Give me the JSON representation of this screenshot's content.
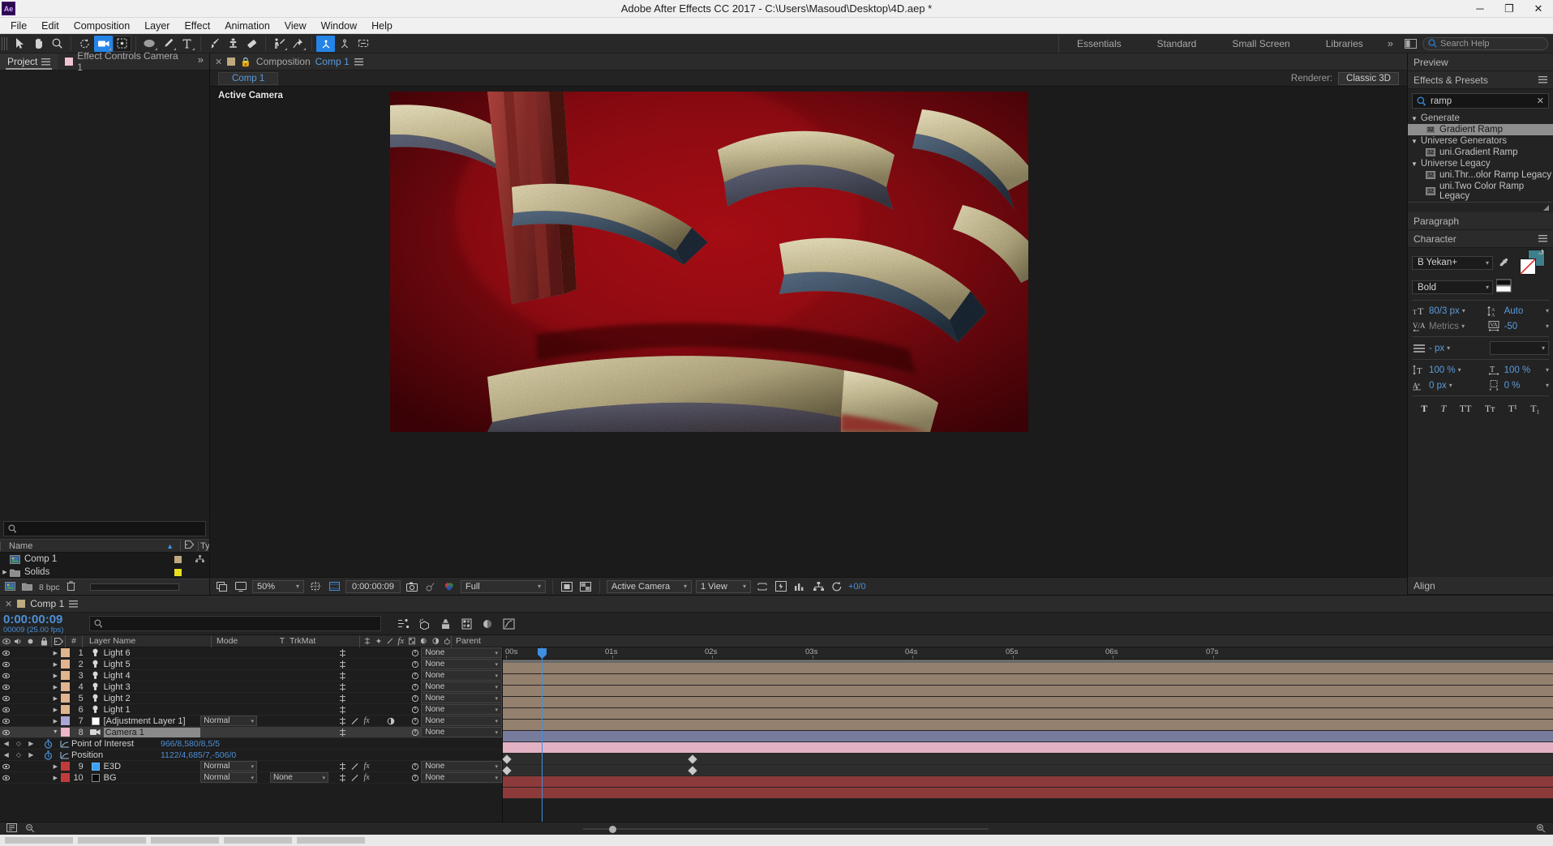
{
  "window": {
    "app_abbrev": "Ae",
    "title": "Adobe After Effects CC 2017 - C:\\Users\\Masoud\\Desktop\\4D.aep *",
    "minimize": "─",
    "maximize": "❐",
    "close": "✕"
  },
  "menubar": [
    "File",
    "Edit",
    "Composition",
    "Layer",
    "Effect",
    "Animation",
    "View",
    "Window",
    "Help"
  ],
  "workspaces": {
    "tabs": [
      "Essentials",
      "Standard",
      "Small Screen",
      "Libraries"
    ],
    "more": "»",
    "search_placeholder": "Search Help"
  },
  "project_panel": {
    "tabs": [
      {
        "label": "Project",
        "active": true
      },
      {
        "label": "Effect Controls  Camera 1",
        "active": false
      }
    ],
    "overflow": "»",
    "search_placeholder": "",
    "columns": [
      "Name",
      "Typ"
    ],
    "items": [
      {
        "name": "Comp 1",
        "kind": "comp",
        "color": "#bfa97e",
        "expandable": false
      },
      {
        "name": "Solids",
        "kind": "folder",
        "color": "#e8e020",
        "expandable": true
      }
    ],
    "bit_depth": "8 bpc"
  },
  "composition_panel": {
    "tab_label": "Composition",
    "tab_comp_name": "Comp 1",
    "breadcrumb": "Comp 1",
    "renderer_label": "Renderer:",
    "renderer_value": "Classic 3D",
    "view_overlay": "Active Camera",
    "bottom_bar": {
      "zoom": "50%",
      "timecode": "0:00:00:09",
      "resolution": "Full",
      "camera": "Active Camera",
      "views": "1 View",
      "frame_offset": "+0/0"
    }
  },
  "preview_panel": {
    "title": "Preview"
  },
  "effects_panel": {
    "title": "Effects & Presets",
    "search_value": "ramp",
    "clear_label": "✕",
    "groups": [
      {
        "name": "Generate",
        "effects": [
          {
            "label": "Gradient Ramp",
            "badge": "32",
            "selected": true
          }
        ]
      },
      {
        "name": "Universe Generators",
        "effects": [
          {
            "label": "uni.Gradient Ramp",
            "badge": "32",
            "selected": false
          }
        ]
      },
      {
        "name": "Universe Legacy",
        "effects": [
          {
            "label": "uni.Thr...olor Ramp Legacy",
            "badge": "32",
            "selected": false
          },
          {
            "label": "uni.Two Color Ramp Legacy",
            "badge": "32",
            "selected": false
          }
        ]
      }
    ]
  },
  "paragraph_panel": {
    "title": "Paragraph"
  },
  "character_panel": {
    "title": "Character",
    "font_family": "B Yekan+",
    "font_style": "Bold",
    "font_size": "80/3 px",
    "leading": "Auto",
    "kerning": "Metrics",
    "tracking": "-50",
    "stroke_width": "- px",
    "stroke_type": "",
    "vertical_scale": "100 %",
    "horizontal_scale": "100 %",
    "baseline_shift": "0 px",
    "tsume": "0 %",
    "fill_color": "#3f7f8c",
    "style_buttons": [
      "T",
      "T",
      "TT",
      "Tᴛ",
      "T¹",
      "T₁"
    ]
  },
  "align_panel": {
    "title": "Align"
  },
  "timeline": {
    "tab_label": "Comp 1",
    "current_time": "0:00:00:09",
    "frame_info": "00009 (25.00 fps)",
    "search_placeholder": "",
    "columns": {
      "hash": "#",
      "layer_name": "Layer Name",
      "mode": "Mode",
      "t": "T",
      "trkmat": "TrkMat",
      "parent": "Parent"
    },
    "ruler_ticks": [
      "00s",
      "01s",
      "02s",
      "03s",
      "04s",
      "05s",
      "06s",
      "07s"
    ],
    "layers": [
      {
        "index": "1",
        "name": "Light 6",
        "type": "light",
        "color": "#e0b48c",
        "bar_color": "#94806e",
        "mode": "",
        "trkmat": "",
        "parent": "None",
        "selected": false,
        "has_fx": false
      },
      {
        "index": "2",
        "name": "Light 5",
        "type": "light",
        "color": "#e0b48c",
        "bar_color": "#94806e",
        "mode": "",
        "trkmat": "",
        "parent": "None",
        "selected": false,
        "has_fx": false
      },
      {
        "index": "3",
        "name": "Light 4",
        "type": "light",
        "color": "#e0b48c",
        "bar_color": "#94806e",
        "mode": "",
        "trkmat": "",
        "parent": "None",
        "selected": false,
        "has_fx": false
      },
      {
        "index": "4",
        "name": "Light 3",
        "type": "light",
        "color": "#e0b48c",
        "bar_color": "#94806e",
        "mode": "",
        "trkmat": "",
        "parent": "None",
        "selected": false,
        "has_fx": false
      },
      {
        "index": "5",
        "name": "Light 2",
        "type": "light",
        "color": "#e0b48c",
        "bar_color": "#94806e",
        "mode": "",
        "trkmat": "",
        "parent": "None",
        "selected": false,
        "has_fx": false
      },
      {
        "index": "6",
        "name": "Light 1",
        "type": "light",
        "color": "#e0b48c",
        "bar_color": "#94806e",
        "mode": "",
        "trkmat": "",
        "parent": "None",
        "selected": false,
        "has_fx": false
      },
      {
        "index": "7",
        "name": "[Adjustment Layer 1]",
        "type": "solid-white",
        "color": "#a9a6d6",
        "bar_color": "#777b9c",
        "mode": "Normal",
        "trkmat": "",
        "parent": "None",
        "selected": false,
        "has_fx": true
      },
      {
        "index": "8",
        "name": "Camera 1",
        "type": "camera",
        "color": "#efb5c8",
        "bar_color": "#e2b2c4",
        "mode": "",
        "trkmat": "",
        "parent": "None",
        "selected": true,
        "has_fx": false
      },
      {
        "index": "9",
        "name": "E3D",
        "type": "solid-blue",
        "color": "#c23b3b",
        "bar_color": "#8d3a3a",
        "mode": "Normal",
        "trkmat": "",
        "parent": "None",
        "selected": false,
        "has_fx": true
      },
      {
        "index": "10",
        "name": "BG",
        "type": "solid-black",
        "color": "#c23b3b",
        "bar_color": "#8d3a3a",
        "mode": "Normal",
        "trkmat": "None",
        "parent": "None",
        "selected": false,
        "has_fx": true
      }
    ],
    "properties": [
      {
        "name": "Point of Interest",
        "value": "966/8,580/8,5/5"
      },
      {
        "name": "Position",
        "value": "1122/4,685/7,-506/0"
      }
    ]
  }
}
